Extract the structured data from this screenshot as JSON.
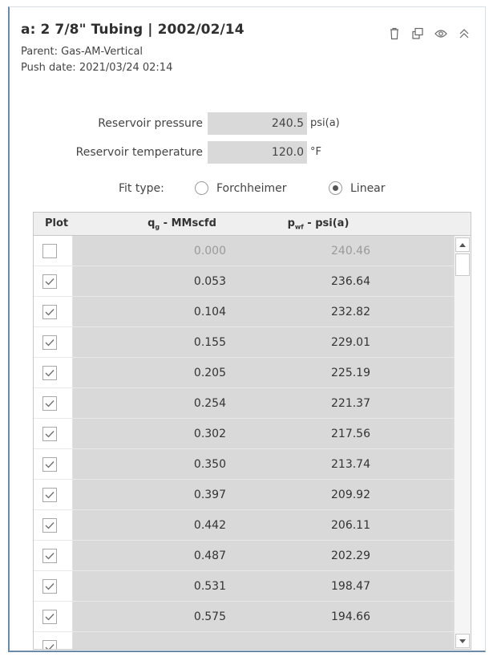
{
  "header": {
    "title": "a: 2 7/8\" Tubing | 2002/02/14",
    "parent": "Parent: Gas-AM-Vertical",
    "push_date": "Push date: 2021/03/24 02:14",
    "icons": [
      "delete-icon",
      "copy-icon",
      "view-icon",
      "collapse-icon"
    ]
  },
  "params": {
    "pressure": {
      "label": "Reservoir pressure",
      "value": "240.5",
      "unit": "psi(a)"
    },
    "temperature": {
      "label": "Reservoir temperature",
      "value": "120.0",
      "unit": "°F"
    }
  },
  "fit": {
    "label": "Fit type:",
    "options": [
      "Forchheimer",
      "Linear"
    ],
    "selected": "Linear"
  },
  "table": {
    "col_plot": "Plot",
    "col_q_main": "q",
    "col_q_sub": "g",
    "col_q_unit": " - MMscfd",
    "col_p_main": "p",
    "col_p_sub": "wf",
    "col_p_unit": " - psi(a)",
    "rows": [
      {
        "checked": false,
        "q": "0.000",
        "p": "240.46"
      },
      {
        "checked": true,
        "q": "0.053",
        "p": "236.64"
      },
      {
        "checked": true,
        "q": "0.104",
        "p": "232.82"
      },
      {
        "checked": true,
        "q": "0.155",
        "p": "229.01"
      },
      {
        "checked": true,
        "q": "0.205",
        "p": "225.19"
      },
      {
        "checked": true,
        "q": "0.254",
        "p": "221.37"
      },
      {
        "checked": true,
        "q": "0.302",
        "p": "217.56"
      },
      {
        "checked": true,
        "q": "0.350",
        "p": "213.74"
      },
      {
        "checked": true,
        "q": "0.397",
        "p": "209.92"
      },
      {
        "checked": true,
        "q": "0.442",
        "p": "206.11"
      },
      {
        "checked": true,
        "q": "0.487",
        "p": "202.29"
      },
      {
        "checked": true,
        "q": "0.531",
        "p": "198.47"
      },
      {
        "checked": true,
        "q": "0.575",
        "p": "194.66"
      },
      {
        "checked": true,
        "q": "",
        "p": ""
      }
    ]
  },
  "colors": {
    "accent_border": "#6b8aa8",
    "cell_fill": "#d9d9d9",
    "header_fill": "#efefef"
  }
}
